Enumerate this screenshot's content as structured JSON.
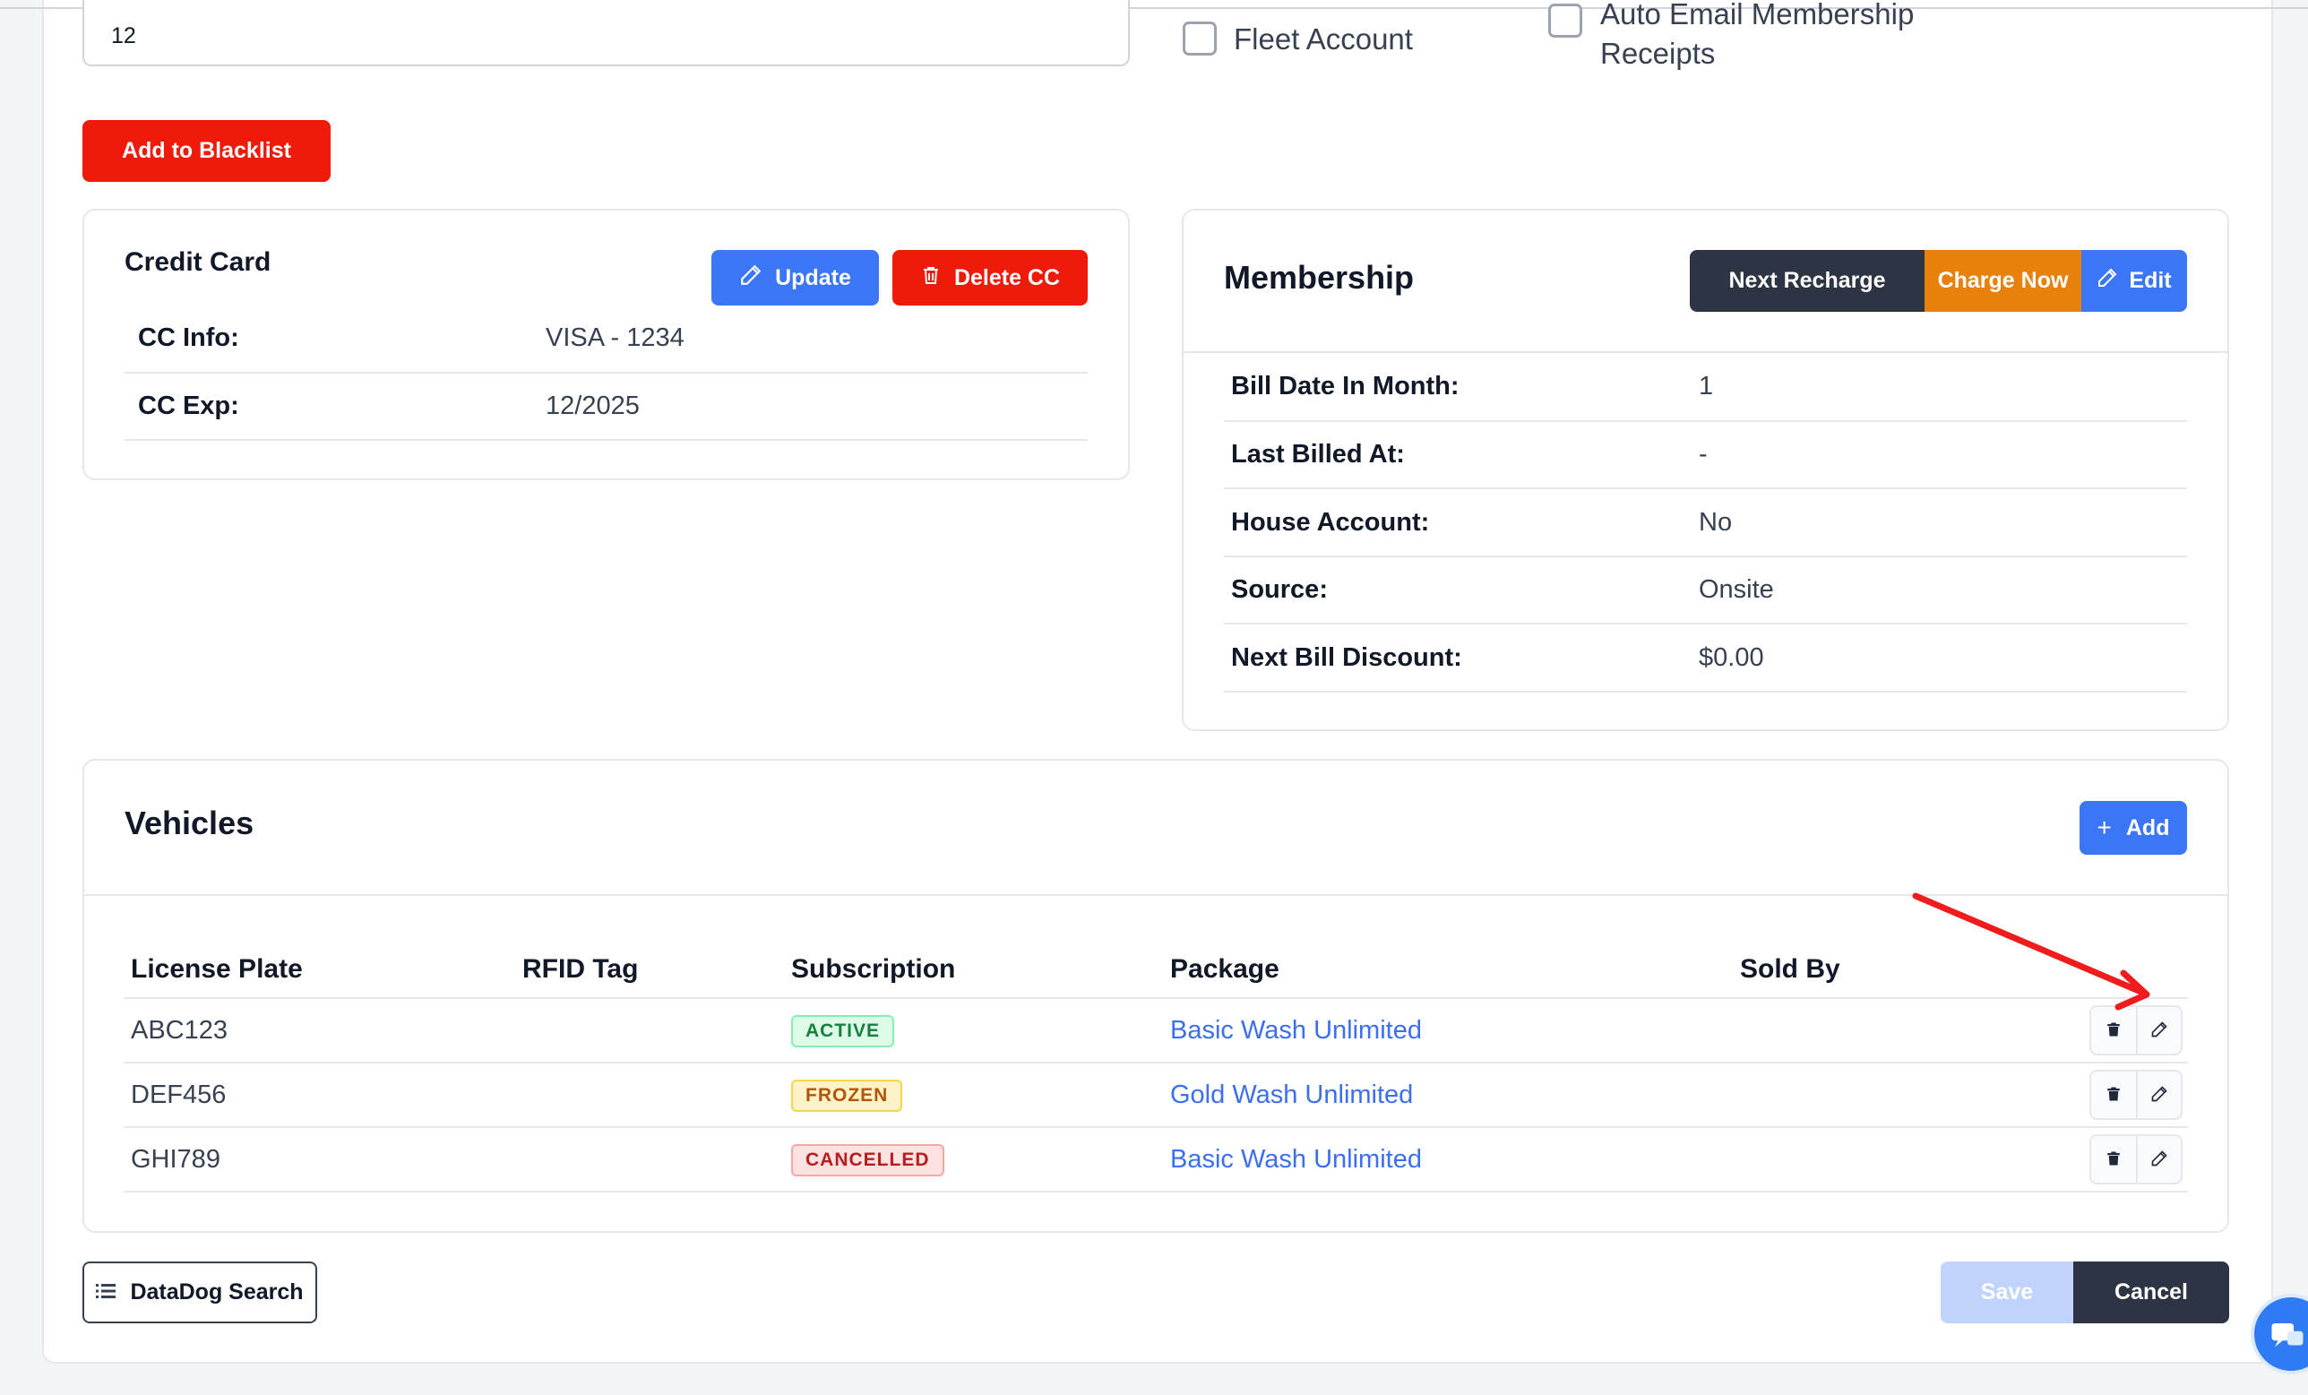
{
  "form": {
    "top_input_value": "12",
    "fleet_account_label": "Fleet Account",
    "auto_email_label_line1": "Auto Email Membership",
    "auto_email_label_line2": "Receipts",
    "blacklist_button": "Add to Blacklist"
  },
  "credit_card": {
    "title": "Credit Card",
    "update_button": "Update",
    "delete_button": "Delete CC",
    "rows": [
      {
        "label": "CC Info:",
        "value": "VISA - 1234"
      },
      {
        "label": "CC Exp:",
        "value": "12/2025"
      }
    ]
  },
  "membership": {
    "title": "Membership",
    "next_recharge_button": "Next Recharge",
    "charge_now_button": "Charge Now",
    "edit_button": "Edit",
    "rows": [
      {
        "label": "Bill Date In Month:",
        "value": "1"
      },
      {
        "label": "Last Billed At:",
        "value": "-"
      },
      {
        "label": "House Account:",
        "value": "No"
      },
      {
        "label": "Source:",
        "value": "Onsite"
      },
      {
        "label": "Next Bill Discount:",
        "value": "$0.00"
      }
    ]
  },
  "vehicles": {
    "title": "Vehicles",
    "add_button": "Add",
    "columns": [
      "License Plate",
      "RFID Tag",
      "Subscription",
      "Package",
      "Sold By"
    ],
    "rows": [
      {
        "plate": "ABC123",
        "rfid": "",
        "subscription": "ACTIVE",
        "package": "Basic Wash Unlimited",
        "sold_by": ""
      },
      {
        "plate": "DEF456",
        "rfid": "",
        "subscription": "FROZEN",
        "package": "Gold Wash Unlimited",
        "sold_by": ""
      },
      {
        "plate": "GHI789",
        "rfid": "",
        "subscription": "CANCELLED",
        "package": "Basic Wash Unlimited",
        "sold_by": ""
      }
    ]
  },
  "footer": {
    "datadog_button": "DataDog Search",
    "save_button": "Save",
    "cancel_button": "Cancel"
  },
  "colors": {
    "danger": "#ef1a0a",
    "primary": "#3b76f6",
    "dark": "#2d3443",
    "warning": "#e8800c",
    "annotation_arrow": "#ee1c1c"
  }
}
